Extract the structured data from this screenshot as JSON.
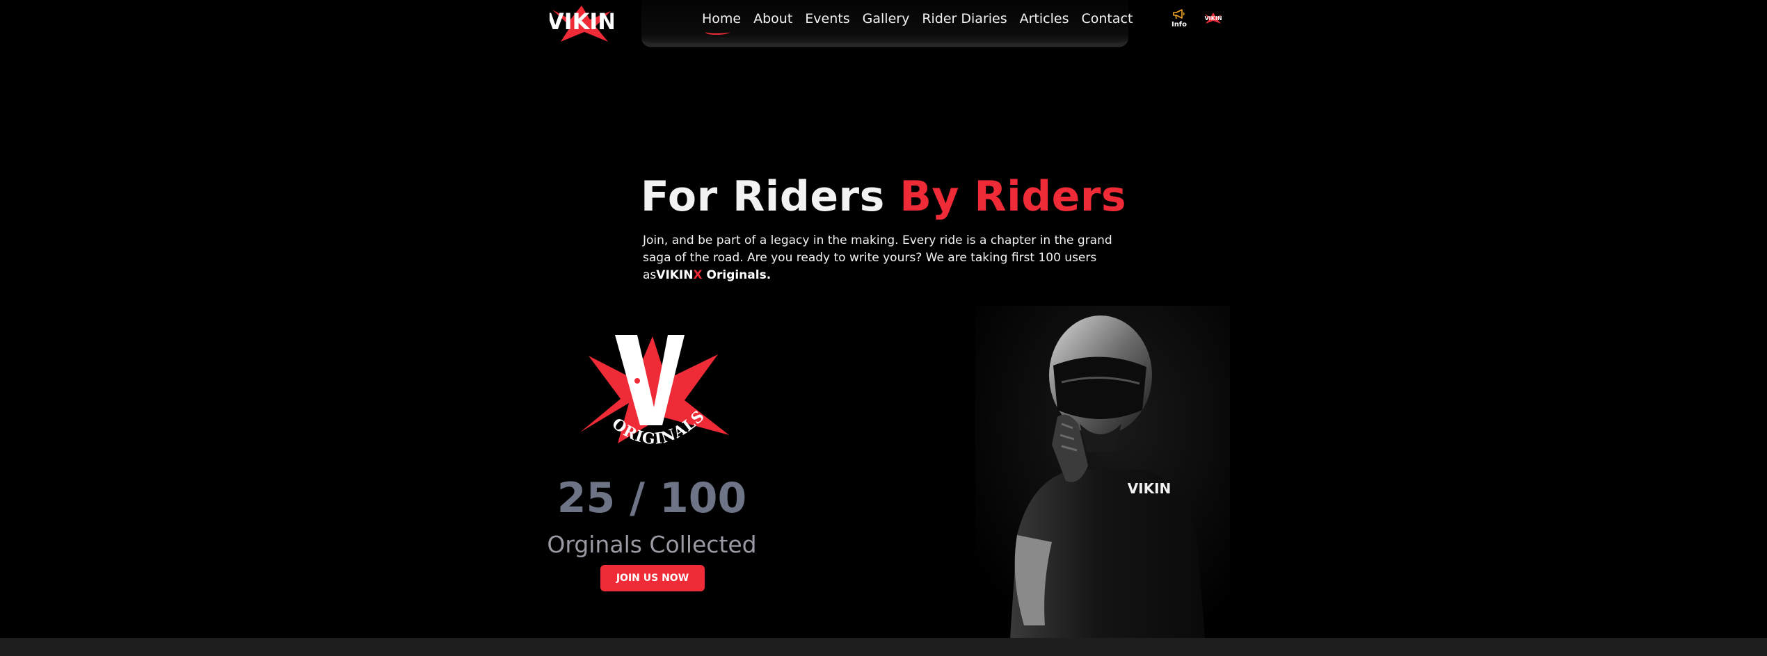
{
  "brand": {
    "logo_text": "VIKIN",
    "small_logo_text": "VIKIN"
  },
  "nav": {
    "items": [
      {
        "label": "Home",
        "active": true
      },
      {
        "label": "About"
      },
      {
        "label": "Events"
      },
      {
        "label": "Gallery"
      },
      {
        "label": "Rider Diaries"
      },
      {
        "label": "Articles"
      },
      {
        "label": "Contact"
      }
    ],
    "info_label": "Info",
    "info_icon": "megaphone-icon"
  },
  "hero": {
    "title_white": "For Riders",
    "title_red": "By Riders",
    "body": "Join, and be part of a legacy in the making. Every ride is a chapter in the grand saga of the road. Are you ready to write yours? We are taking first 100 users as",
    "brand_text": "VIKIN",
    "brand_x": "X",
    "brand_suffix": " Originals."
  },
  "originals": {
    "badge_letter": "V",
    "badge_text": "ORIGINALS",
    "count": "25 / 100",
    "count_label": "Orginals Collected",
    "join_button": "JOIN US NOW"
  },
  "rider_shirt_text": "VIKIN",
  "colors": {
    "accent": "#ee2b36",
    "background": "#000000",
    "count_text": "#6c7486",
    "muted_text": "#9a9aa4"
  }
}
